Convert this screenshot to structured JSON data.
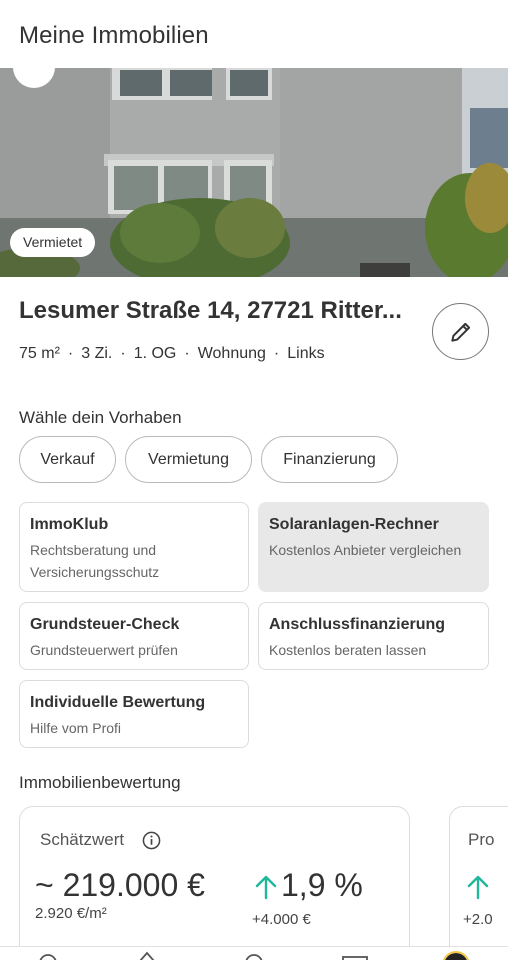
{
  "header": {
    "title": "Meine Immobilien"
  },
  "property": {
    "status_badge": "Vermietet",
    "address": "Lesumer Straße 14, 27721 Ritter...",
    "facts": [
      "75 m²",
      "3 Zi.",
      "1. OG",
      "Wohnung",
      "Links"
    ],
    "fact_separator": "·"
  },
  "plans": {
    "heading": "Wähle dein Vorhaben",
    "chips": [
      "Verkauf",
      "Vermietung",
      "Finanzierung"
    ]
  },
  "services": [
    {
      "title": "ImmoKlub",
      "subtitle": "Rechtsberatung und Versicherungsschutz"
    },
    {
      "title": "Solaranlagen-Rechner",
      "subtitle": "Kostenlos Anbieter vergleichen"
    },
    {
      "title": "Grundsteuer-Check",
      "subtitle": "Grundsteuerwert prüfen"
    },
    {
      "title": "Anschlussfinanzierung",
      "subtitle": "Kostenlos beraten lassen"
    },
    {
      "title": "Individuelle Bewertung",
      "subtitle": "Hilfe vom Profi"
    }
  ],
  "valuation": {
    "heading": "Immobilienbewertung",
    "card1": {
      "label": "Schätzwert",
      "value": "~ 219.000 €",
      "per_sqm": "2.920 €/m²",
      "change_percent": "1,9 %",
      "change_abs": "+4.000 €"
    },
    "card2": {
      "label_partial": "Pro",
      "change_abs_partial": "+2.0"
    }
  },
  "colors": {
    "text": "#333333",
    "accent_up": "#1fb89a",
    "card_gray": "#e8e8e8"
  },
  "icons": {
    "edit": "pencil-icon",
    "info": "info-icon",
    "trend": "arrow-up-icon"
  }
}
